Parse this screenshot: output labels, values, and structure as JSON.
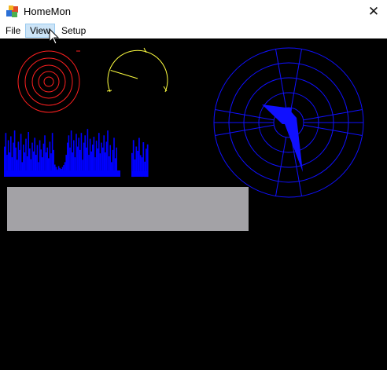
{
  "window": {
    "title": "HomeMon",
    "close_glyph": "✕"
  },
  "menu": {
    "items": [
      {
        "label": "File"
      },
      {
        "label": "View"
      },
      {
        "label": "Setup"
      }
    ]
  },
  "colors": {
    "background": "#000000",
    "rings": "#ff2020",
    "gauge": "#ffff40",
    "radar": "#1010ff",
    "bars": "#0000ff",
    "panel": "#a3a2a6"
  },
  "gauge": {
    "needle_level": 0.18
  },
  "bars": {
    "values": [
      0.62,
      0.9,
      0.45,
      0.75,
      0.5,
      0.83,
      0.4,
      0.7,
      0.95,
      0.6,
      0.35,
      0.72,
      0.55,
      0.88,
      0.3,
      0.66,
      0.5,
      0.78,
      0.42,
      0.92,
      0.58,
      0.36,
      0.7,
      0.52,
      0.8,
      0.45,
      0.65,
      0.3,
      0.75,
      0.56,
      0.4,
      0.68,
      0.85,
      0.5,
      0.6,
      0.38,
      0.72,
      0.48,
      0.9,
      0.55,
      0.25,
      0.2,
      0.15,
      0.22,
      0.18,
      0.16,
      0.2,
      0.24,
      0.3,
      0.45,
      0.7,
      0.85,
      0.6,
      0.95,
      0.5,
      0.75,
      0.4,
      0.88,
      0.62,
      0.8,
      0.55,
      0.9,
      0.35,
      0.7,
      0.85,
      0.6,
      0.98,
      0.45,
      0.78,
      0.52,
      0.66,
      0.82,
      0.4,
      0.74,
      0.58,
      0.9,
      0.48,
      0.7,
      0.6,
      0.85,
      0.5,
      0.72,
      0.95,
      0.42,
      0.65,
      0.3,
      0.55,
      0.8,
      0.38,
      0.6
    ],
    "values_b": [
      0.55,
      0.85,
      0.4,
      0.7,
      0.6,
      0.9,
      0.5,
      0.45,
      0.8,
      0.35,
      0.65,
      0.75
    ]
  },
  "radar": {
    "rings": 5,
    "spokes_deg": [
      10,
      80,
      100,
      170,
      190,
      260,
      280,
      350
    ],
    "arrow_a_deg": 320,
    "arrow_a_len": 0.4,
    "arrow_b_deg": 160,
    "arrow_b_len": 0.85
  }
}
